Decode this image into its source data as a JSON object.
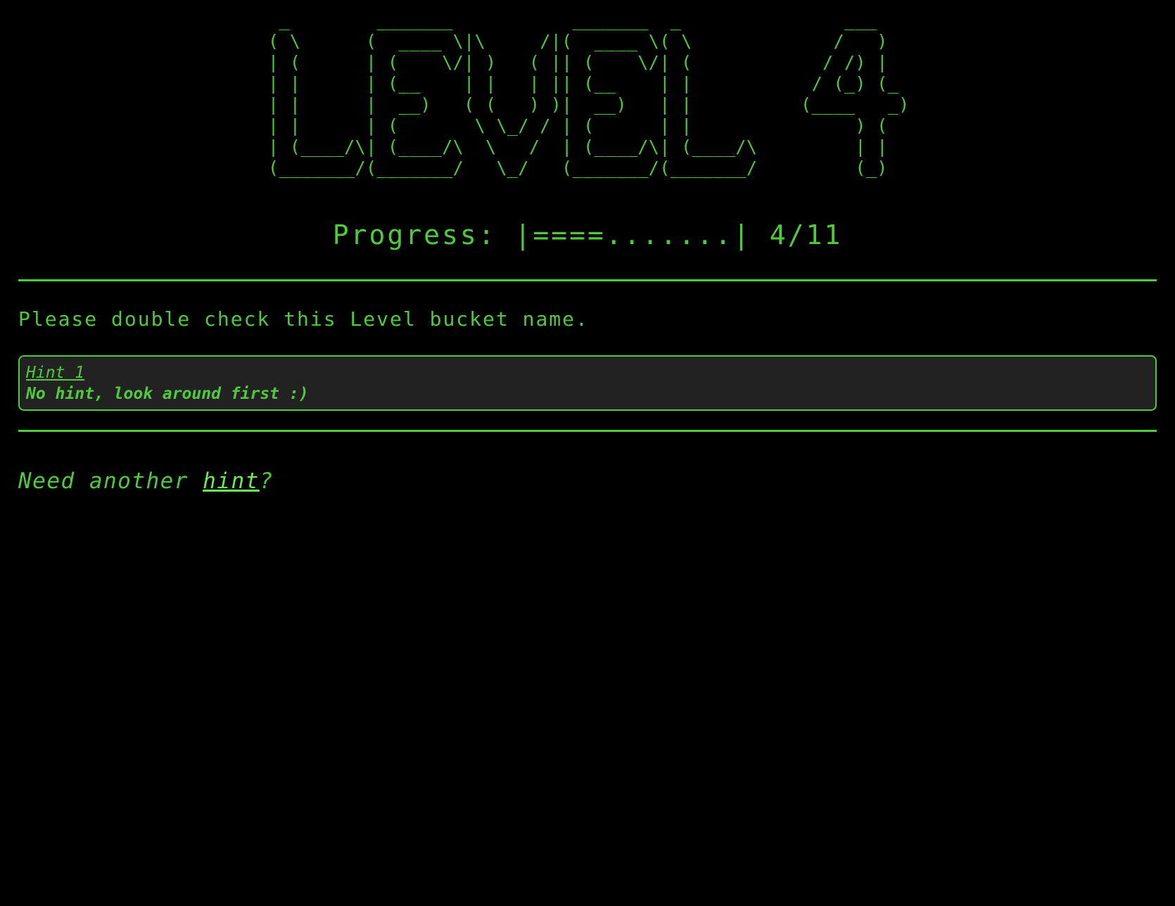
{
  "level_banner_ascii": " _        _______           _______  _               ___   \n( \\      (  ____ \\|\\     /|(  ____ \\( \\             /   )  \n| (      | (    \\/| )   ( || (    \\/| (            / /) |  \n| |      | (__    | |   | || (__    | |           / (_) (_ \n| |      |  __)   ( (   ) )|  __)   | |          (____   _)\n| |      | (       \\ \\_/ / | (      | |               ) (  \n| (____/\\| (____/\\  \\   /  | (____/\\| (____/\\         | |  \n(_______/(_______/   \\_/   (_______/(_______/         (_)  ",
  "progress": {
    "label": "Progress: |====.......| 4/11",
    "current": 4,
    "total": 11
  },
  "message": "Please double check this Level bucket name.",
  "hint_box": {
    "title": "Hint 1",
    "text": "No hint, look around first :)"
  },
  "another_hint": {
    "prefix": "Need another ",
    "link_label": "hint",
    "suffix": "?"
  },
  "colors": {
    "background": "#000000",
    "accent_green": "#4fca3b",
    "hint_box_bg": "#222222"
  }
}
